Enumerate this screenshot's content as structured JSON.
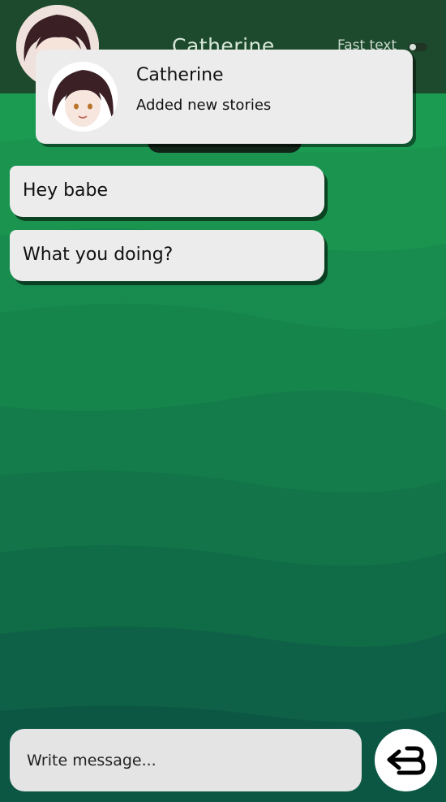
{
  "header": {
    "name": "Catherine",
    "fast_text_label": "Fast text"
  },
  "notification": {
    "title": "Catherine",
    "text": "Added new stories"
  },
  "messages": [
    {
      "text": "Hey babe",
      "from": "contact"
    },
    {
      "text": "What you doing?",
      "from": "contact"
    }
  ],
  "composer": {
    "placeholder": "Write message..."
  },
  "colors": {
    "header_bg": "#1d4a2c",
    "bubble_bg": "#ececec",
    "accent_green": "#1a9a50"
  },
  "icons": {
    "send": "return-arrow-icon",
    "avatar": "profile-avatar"
  }
}
